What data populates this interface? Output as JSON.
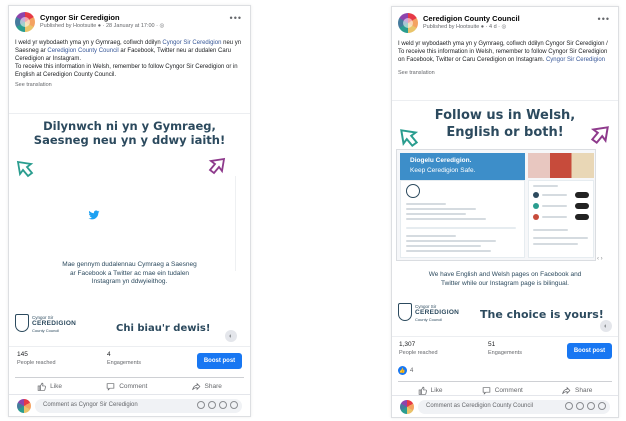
{
  "post_a": {
    "page_name": "Cyngor Sir Ceredigion",
    "meta": "Published by Hootsuite ● · 28 January at 17:00 · ◎",
    "text_1": "I weld yr wybodaeth yma yn y Gymraeg, cofiwch ddilyn ",
    "link_1": "Cyngor Sir Ceredigion",
    "text_2": " neu yn Saesneg ar ",
    "link_2": "Ceredigion County Council",
    "text_3": " ar Facebook, Twitter neu ar dudalen Caru Ceredigion ar Instagram.",
    "text_4": "To receive this information in Welsh, remember to follow Cyngor Sir Ceredigion or in English at Ceredigion County Council.",
    "see_translation": "See translation",
    "graphic": {
      "headline": "Dilynwch ni yn y Gymraeg, Saesneg neu yn y ddwy iaith!",
      "body": "Mae gennym dudalennau Cymraeg a Saesneg ar Facebook a Twitter ac mae ein tudalen Instagram yn ddwyieithog.",
      "slogan": "Chi biau'r dewis!",
      "logo_line1": "Cyngor Sir",
      "logo_line2": "CEREDIGION",
      "logo_line3": "County Council"
    },
    "stats": {
      "reached": "145",
      "reached_label": "People reached",
      "engagements": "4",
      "engagements_label": "Engagements"
    },
    "boost_label": "Boost post",
    "actions": {
      "like": "Like",
      "comment": "Comment",
      "share": "Share"
    },
    "comment_placeholder": "Comment as Cyngor Sir Ceredigion"
  },
  "post_b": {
    "page_name": "Ceredigion County Council",
    "meta": "Published by Hootsuite ● · 4 d · ◎",
    "text_1": "I weld yr wybodaeth yma yn y Gymraeg, cofiwch ddilyn Cyngor Sir Ceredigion / To receive this information in Welsh, remember to follow Cyngor Sir Ceredigion on Facebook, Twitter or Caru Ceredigion on Instagram. ",
    "link_1": "Cyngor Sir Ceredigion",
    "see_translation": "See translation",
    "graphic": {
      "headline": "Follow us in Welsh, English or both!",
      "banner_line1": "Diogelu Ceredigion.",
      "banner_line2": "Keep Ceredigion Safe.",
      "body": "We have English and Welsh pages on Facebook and Twitter while our Instagram page is bilingual.",
      "slogan": "The choice is yours!",
      "logo_line1": "Cyngor Sir",
      "logo_line2": "CEREDIGION",
      "logo_line3": "County Council"
    },
    "stats": {
      "reached": "1,307",
      "reached_label": "People reached",
      "engagements": "51",
      "engagements_label": "Engagements"
    },
    "reactions": "4",
    "boost_label": "Boost post",
    "actions": {
      "like": "Like",
      "comment": "Comment",
      "share": "Share"
    },
    "comment_placeholder": "Comment as Ceredigion County Council"
  },
  "colors": {
    "brand": "#1877f2",
    "headline": "#2c4a5e",
    "link": "#385898",
    "arrow_green": "#2a9d8f",
    "arrow_purple": "#8e3a8c"
  },
  "icons": [
    "like-icon",
    "comment-icon",
    "share-icon",
    "twitter-icon",
    "more-options-icon",
    "globe-icon",
    "arrow-icon"
  ]
}
